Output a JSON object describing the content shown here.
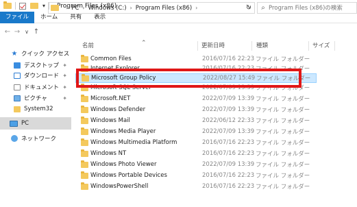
{
  "window": {
    "title": "Program Files (x86)"
  },
  "ribbon": {
    "tabs": [
      {
        "label": "ファイル"
      },
      {
        "label": "ホーム"
      },
      {
        "label": "共有"
      },
      {
        "label": "表示"
      }
    ]
  },
  "address": {
    "crumbs": [
      "PC",
      "Windows (C:)",
      "Program Files (x86)"
    ]
  },
  "search": {
    "placeholder": "Program Files (x86)の検索"
  },
  "nav": {
    "items": [
      {
        "label": "クイック アクセス",
        "icon": "star-icon"
      },
      {
        "label": "デスクトップ",
        "icon": "desktop-icon",
        "pinned": true
      },
      {
        "label": "ダウンロード",
        "icon": "download-icon",
        "pinned": true
      },
      {
        "label": "ドキュメント",
        "icon": "document-icon",
        "pinned": true
      },
      {
        "label": "ピクチャ",
        "icon": "pictures-icon",
        "pinned": true
      },
      {
        "label": "System32",
        "icon": "folder-icon"
      },
      {
        "label": "PC",
        "icon": "pc-icon",
        "selected": true
      },
      {
        "label": "ネットワーク",
        "icon": "network-icon"
      }
    ]
  },
  "list": {
    "headers": {
      "name": "名前",
      "date": "更新日時",
      "type": "種類",
      "size": "サイズ"
    },
    "rows": [
      {
        "name": "Common Files",
        "date": "2016/07/16 22:23",
        "type": "ファイル フォルダー"
      },
      {
        "name": "Internet Explorer",
        "date": "2016/07/16 22:23",
        "type": "ファイル フォルダー"
      },
      {
        "name": "Microsoft Group Policy",
        "date": "2022/08/27 15:49",
        "type": "ファイル フォルダー",
        "selected": true
      },
      {
        "name": "Microsoft SQL Server",
        "date": "2022/07/09 13:39",
        "type": "ファイル フォルダー"
      },
      {
        "name": "Microsoft.NET",
        "date": "2022/07/09 13:39",
        "type": "ファイル フォルダー"
      },
      {
        "name": "Windows Defender",
        "date": "2022/07/09 13:39",
        "type": "ファイル フォルダー"
      },
      {
        "name": "Windows Mail",
        "date": "2022/06/12 22:33",
        "type": "ファイル フォルダー"
      },
      {
        "name": "Windows Media Player",
        "date": "2022/07/09 13:39",
        "type": "ファイル フォルダー"
      },
      {
        "name": "Windows Multimedia Platform",
        "date": "2016/07/16 22:23",
        "type": "ファイル フォルダー"
      },
      {
        "name": "Windows NT",
        "date": "2016/07/16 22:23",
        "type": "ファイル フォルダー"
      },
      {
        "name": "Windows Photo Viewer",
        "date": "2022/07/09 13:39",
        "type": "ファイル フォルダー"
      },
      {
        "name": "Windows Portable Devices",
        "date": "2016/07/16 22:23",
        "type": "ファイル フォルダー"
      },
      {
        "name": "WindowsPowerShell",
        "date": "2016/07/16 22:23",
        "type": "ファイル フォルダー"
      }
    ]
  },
  "colors": {
    "accent": "#1979ca",
    "selection": "#cce8ff",
    "highlight": "#e01717",
    "folder": "#f4c95d"
  }
}
